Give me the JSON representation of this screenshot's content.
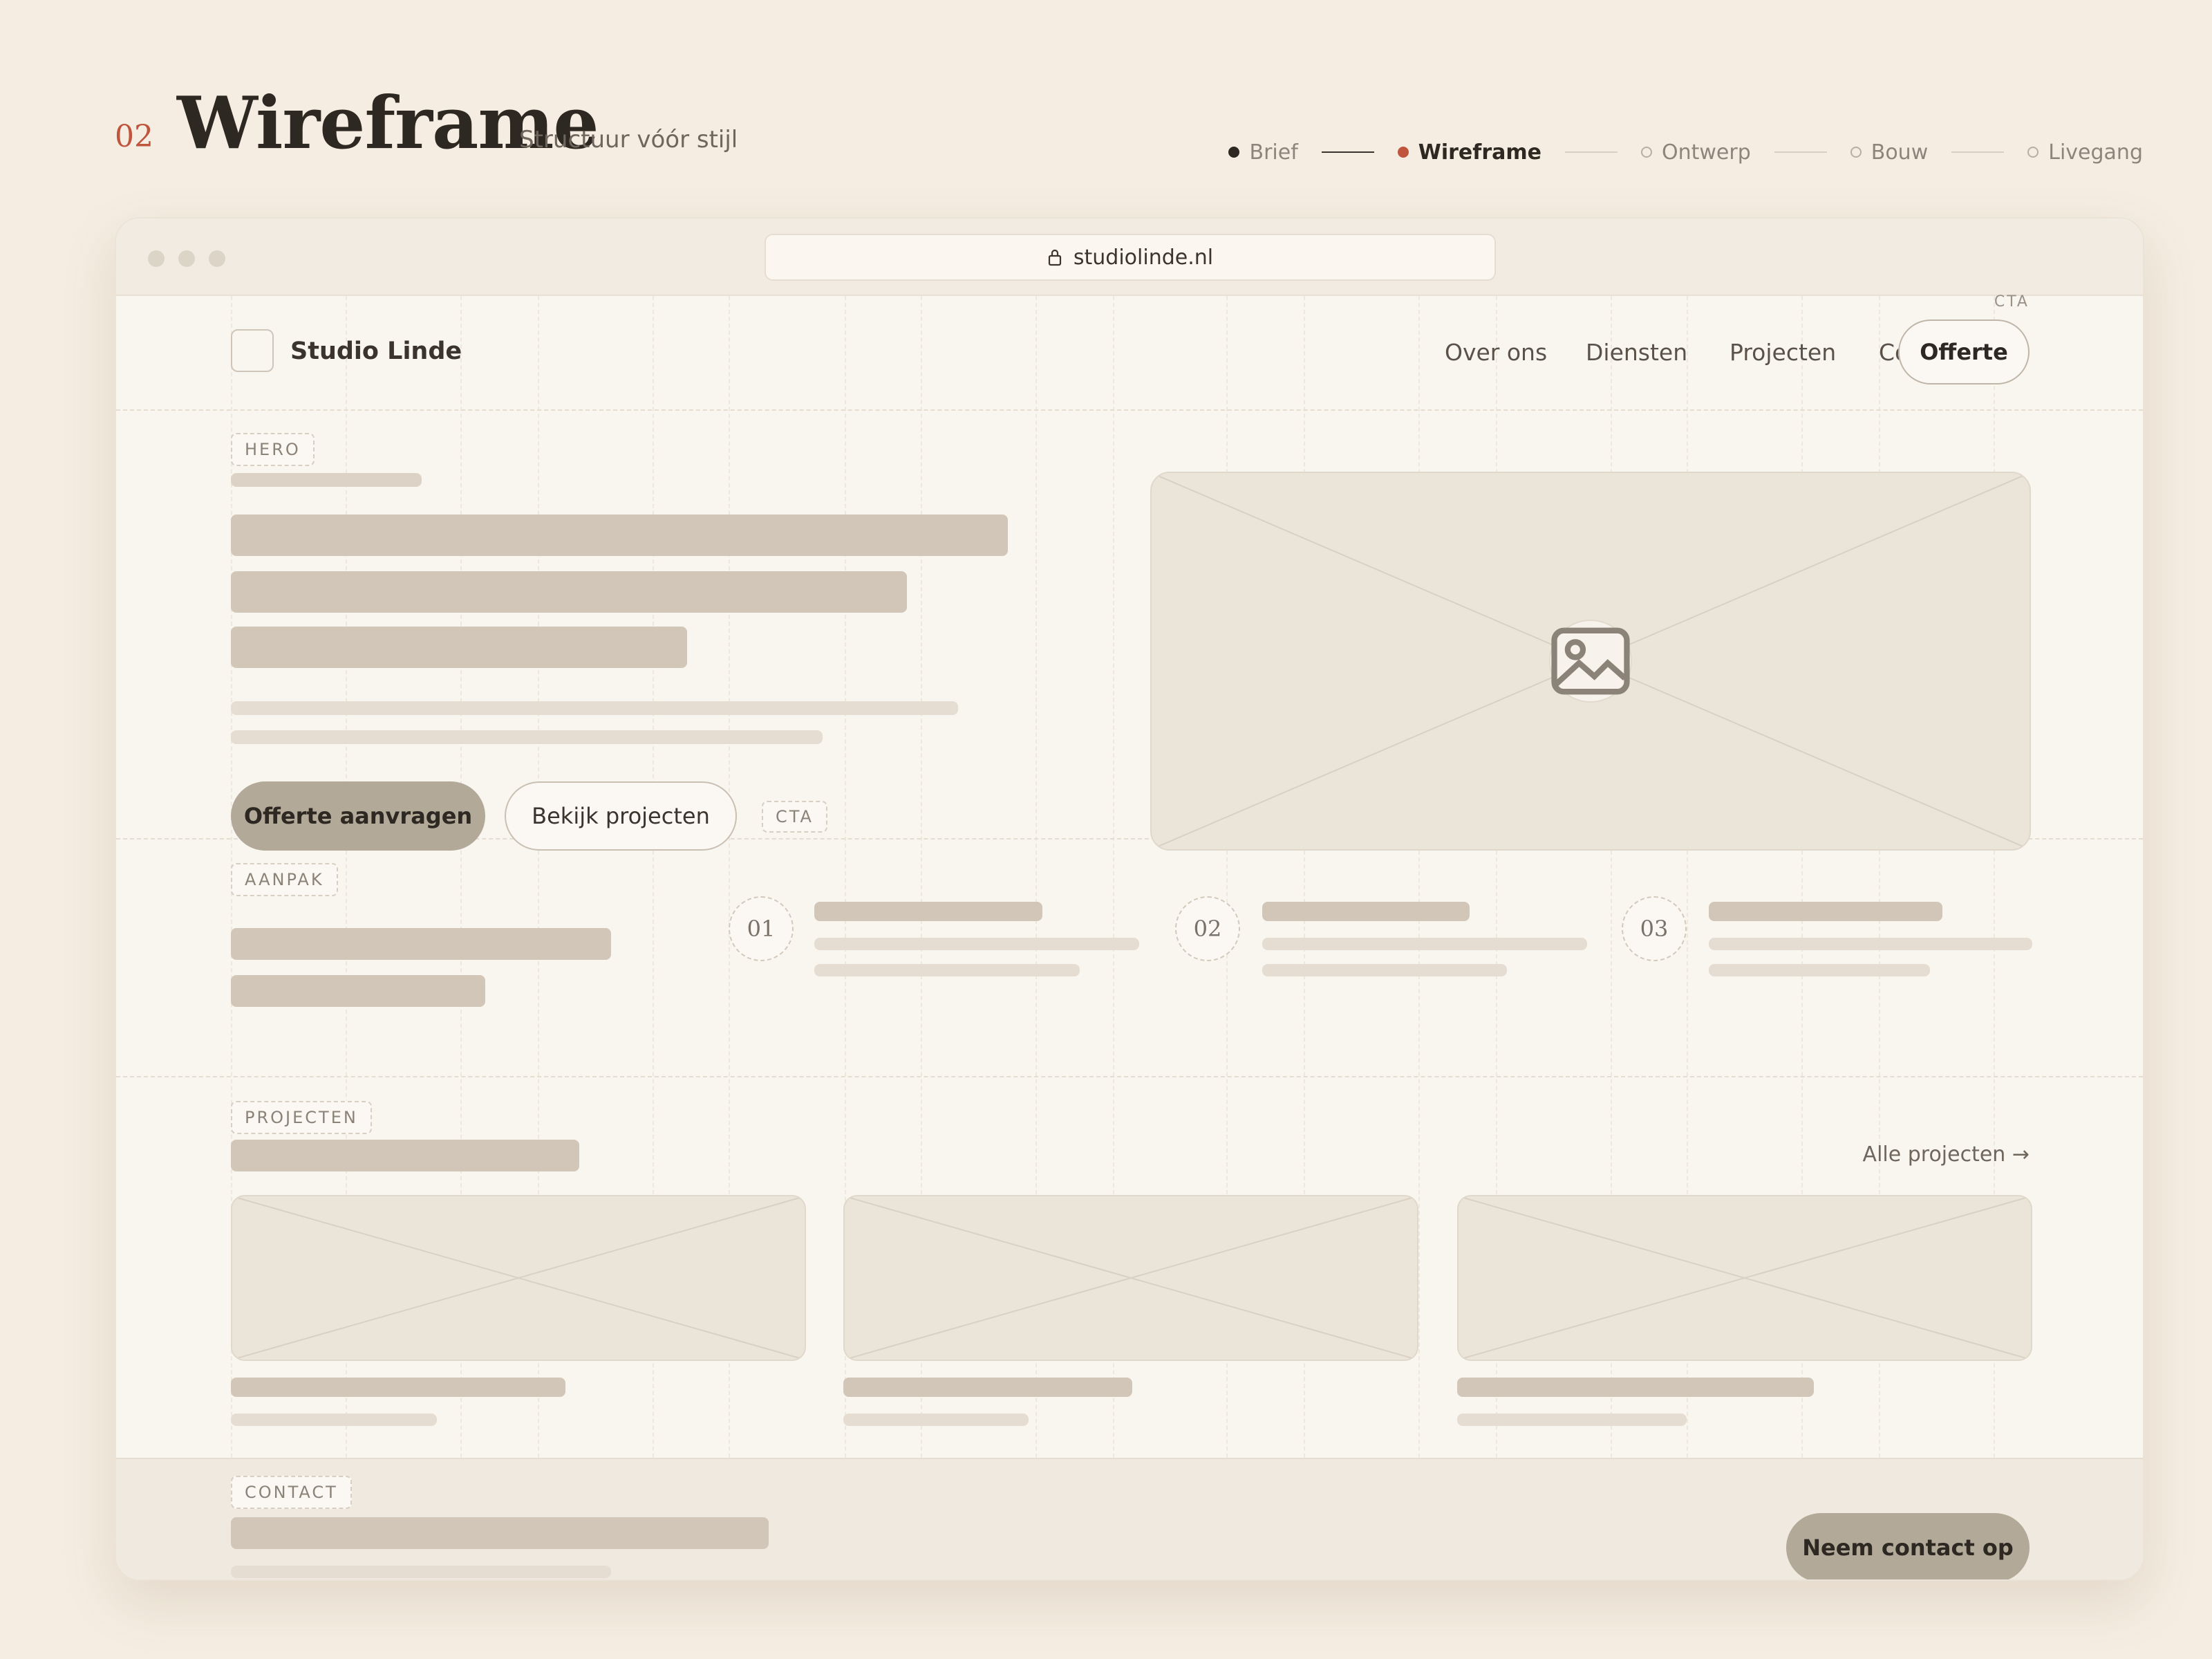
{
  "header": {
    "step_number": "02",
    "title": "Wireframe",
    "subtitle": "Structuur vóór stijl",
    "steps": [
      {
        "label": "Brief",
        "state": "done"
      },
      {
        "label": "Wireframe",
        "state": "active"
      },
      {
        "label": "Ontwerp",
        "state": "todo"
      },
      {
        "label": "Bouw",
        "state": "todo"
      },
      {
        "label": "Livegang",
        "state": "todo"
      }
    ]
  },
  "browser": {
    "url": "studiolinde.nl",
    "icons": {
      "lock": "lock-icon"
    }
  },
  "site": {
    "brand": "Studio Linde",
    "nav": [
      "Over ons",
      "Diensten",
      "Projecten",
      "Contact"
    ],
    "nav_cta_tag": "CTA",
    "nav_cta": "Offerte",
    "hero": {
      "tag": "HERO",
      "primary_button": "Offerte aanvragen",
      "secondary_button": "Bekijk projecten",
      "cta_tag": "CTA",
      "image_icon": "image-icon"
    },
    "approach": {
      "tag": "AANPAK",
      "steps": [
        "01",
        "02",
        "03"
      ]
    },
    "projects": {
      "tag": "PROJECTEN",
      "link": "Alle projecten →"
    },
    "contact": {
      "tag": "CONTACT",
      "button": "Neem contact op"
    }
  },
  "colors": {
    "background": "#f5ede2",
    "accent": "#c0553d",
    "placeholder": "#d1c6b8",
    "button": "#b3a999"
  }
}
